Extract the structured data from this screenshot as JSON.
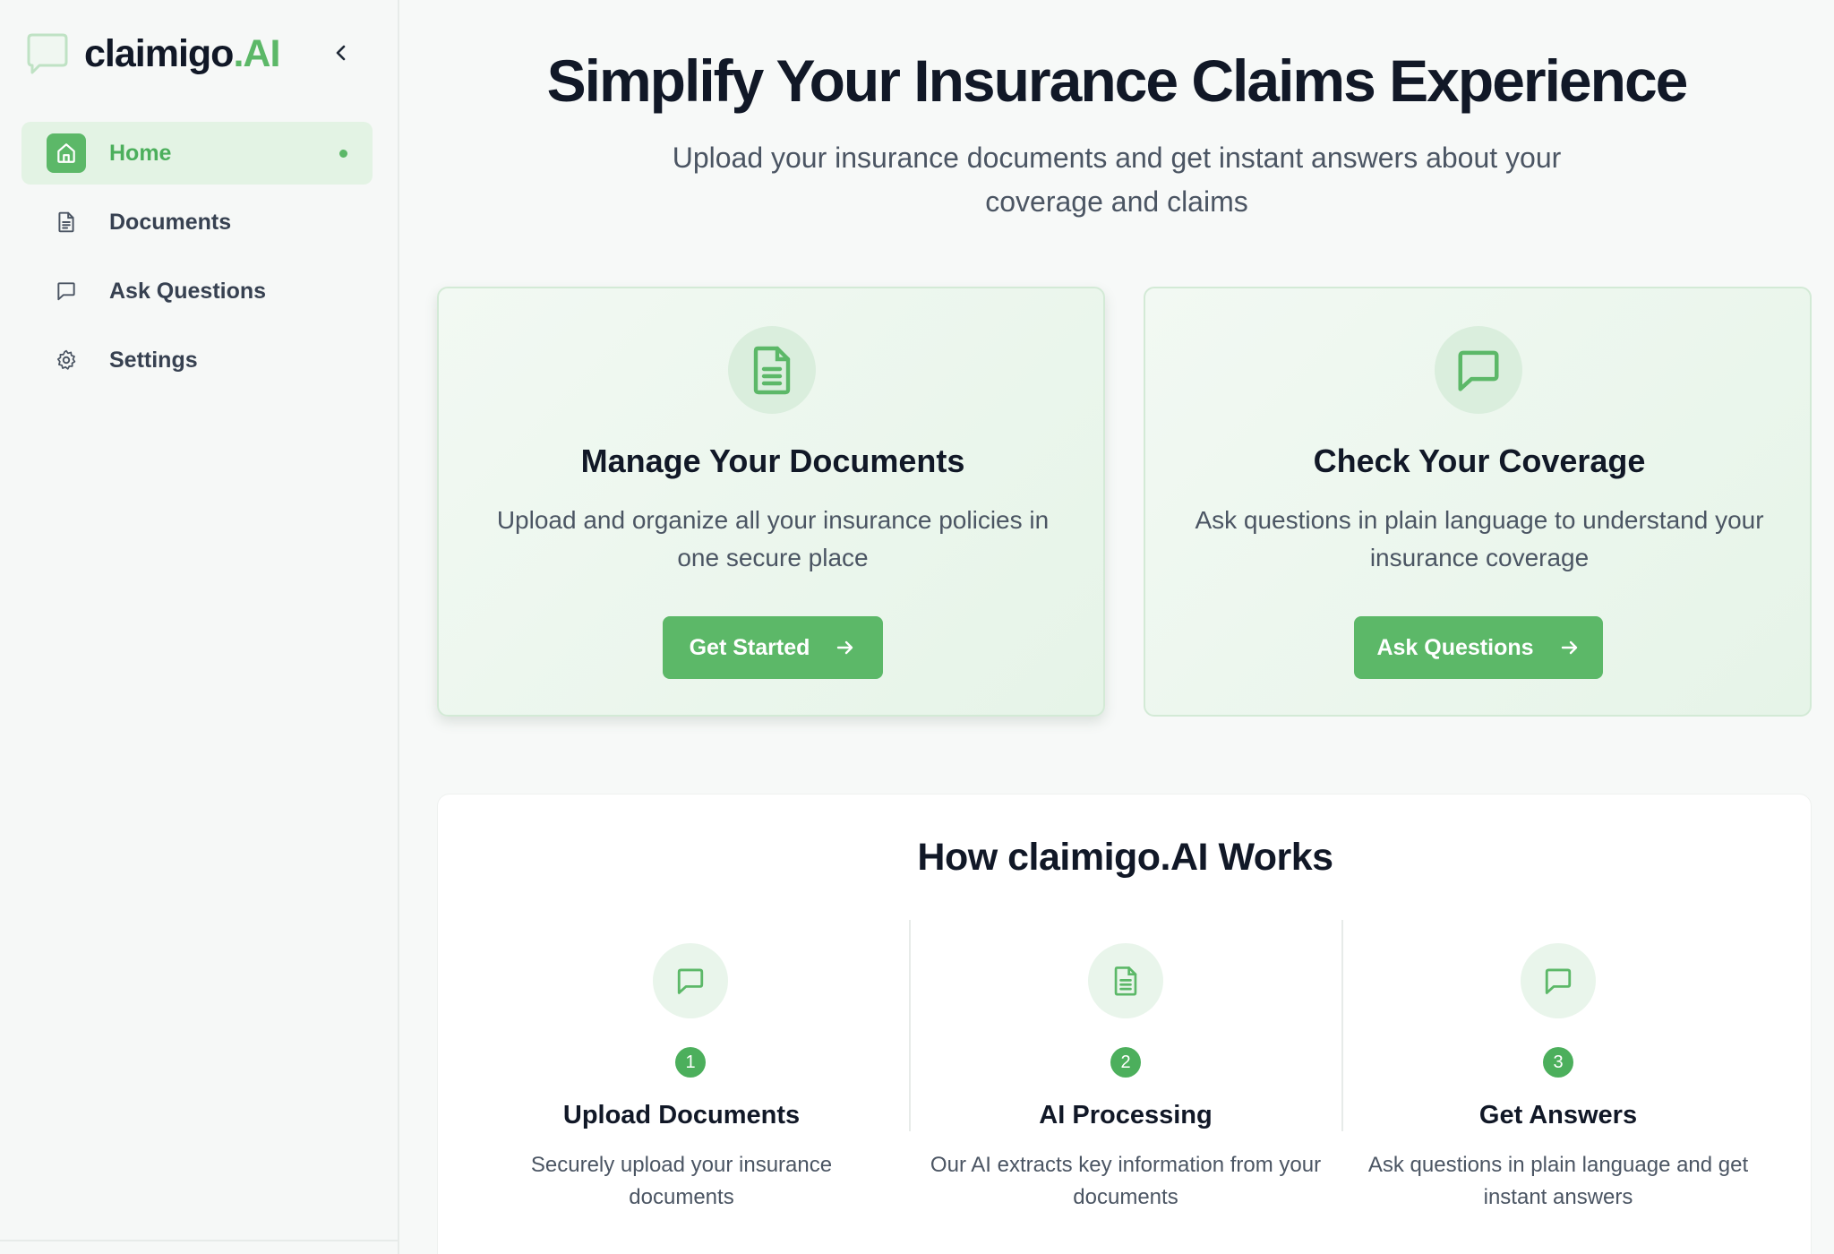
{
  "brand": {
    "name": "claimigo",
    "accent": ".AI",
    "color": "#5cb868"
  },
  "sidebar": {
    "items": [
      {
        "label": "Home",
        "icon": "home-icon",
        "active": true
      },
      {
        "label": "Documents",
        "icon": "document-icon",
        "active": false
      },
      {
        "label": "Ask Questions",
        "icon": "message-icon",
        "active": false
      },
      {
        "label": "Settings",
        "icon": "gear-icon",
        "active": false
      }
    ]
  },
  "hero": {
    "title": "Simplify Your Insurance Claims Experience",
    "subtitle": "Upload your insurance documents and get instant answers about your coverage and claims"
  },
  "cards": [
    {
      "title": "Manage Your Documents",
      "description": "Upload and organize all your insurance policies in one secure place",
      "button": "Get Started",
      "icon": "document-icon"
    },
    {
      "title": "Check Your Coverage",
      "description": "Ask questions in plain language to understand your insurance coverage",
      "button": "Ask Questions",
      "icon": "message-icon"
    }
  ],
  "how": {
    "title": "How claimigo.AI Works",
    "steps": [
      {
        "num": "1",
        "title": "Upload Documents",
        "description": "Securely upload your insurance documents",
        "icon": "message-icon"
      },
      {
        "num": "2",
        "title": "AI Processing",
        "description": "Our AI extracts key information from your documents",
        "icon": "document-icon"
      },
      {
        "num": "3",
        "title": "Get Answers",
        "description": "Ask questions in plain language and get instant answers",
        "icon": "message-icon"
      }
    ]
  }
}
